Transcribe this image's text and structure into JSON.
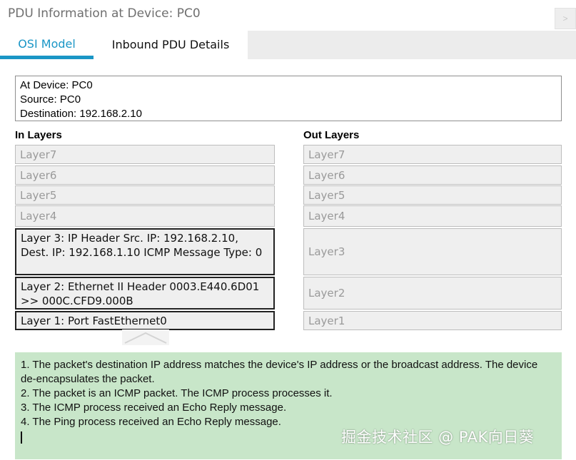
{
  "window": {
    "title": "PDU Information at Device: PC0",
    "close_label": ">"
  },
  "tabs": [
    {
      "label": "OSI Model",
      "active": true
    },
    {
      "label": "Inbound PDU Details",
      "active": false
    }
  ],
  "info": {
    "device": "At Device: PC0",
    "source": "Source: PC0",
    "destination": "Destination: 192.168.2.10"
  },
  "in_layers": {
    "heading": "In Layers",
    "items": [
      "Layer7",
      "Layer6",
      "Layer5",
      "Layer4",
      "Layer 3: IP Header Src. IP: 192.168.2.10, Dest. IP: 192.168.1.10 ICMP Message Type: 0",
      "Layer 2: Ethernet II Header 0003.E440.6D01 >> 000C.CFD9.000B",
      "Layer 1: Port FastEthernet0"
    ]
  },
  "out_layers": {
    "heading": "Out Layers",
    "items": [
      "Layer7",
      "Layer6",
      "Layer5",
      "Layer4",
      "Layer3",
      "Layer2",
      "Layer1"
    ]
  },
  "description": [
    "1. The packet's destination IP address matches the device's IP address or the broadcast address. The device de-encapsulates the packet.",
    "2. The packet is an ICMP packet. The ICMP process processes it.",
    "3. The ICMP process received an Echo Reply message.",
    "4. The Ping process received an Echo Reply message."
  ],
  "watermark": "掘金技术社区 @ PAK向日葵",
  "colors": {
    "accent": "#1a96c6",
    "description_bg": "#c8e6c9",
    "layer_bg": "#efefef"
  }
}
